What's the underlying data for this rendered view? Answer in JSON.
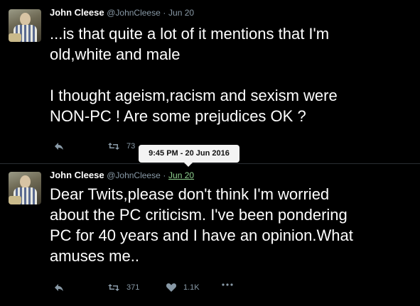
{
  "tweets": [
    {
      "author_name": "John Cleese",
      "handle": "@JohnCleese",
      "separator": "·",
      "date": "Jun 20",
      "text": "...is that quite a lot of it mentions that I'm\nold,white and male\n\nI thought ageism,racism and sexism were\nNON-PC ! Are some prejudices OK ?",
      "actions": {
        "retweets": "73"
      }
    },
    {
      "author_name": "John Cleese",
      "handle": "@JohnCleese",
      "separator": "·",
      "date": "Jun 20",
      "text": "Dear Twits,please don't think I'm worried\nabout the PC criticism. I've been pondering\nPC for 40 years and I have an opinion.What\namuses me..",
      "actions": {
        "retweets": "371",
        "likes": "1.1K"
      }
    }
  ],
  "tooltip": {
    "text": "9:45 PM - 20 Jun 2016"
  },
  "icons": [
    "reply-icon",
    "retweet-icon",
    "like-icon",
    "more-icon",
    "avatar"
  ],
  "colors": {
    "background": "#000000",
    "text": "#ffffff",
    "muted": "#8899a6",
    "hover_link": "#8fd18f",
    "tooltip_bg": "#f3f3f3"
  }
}
